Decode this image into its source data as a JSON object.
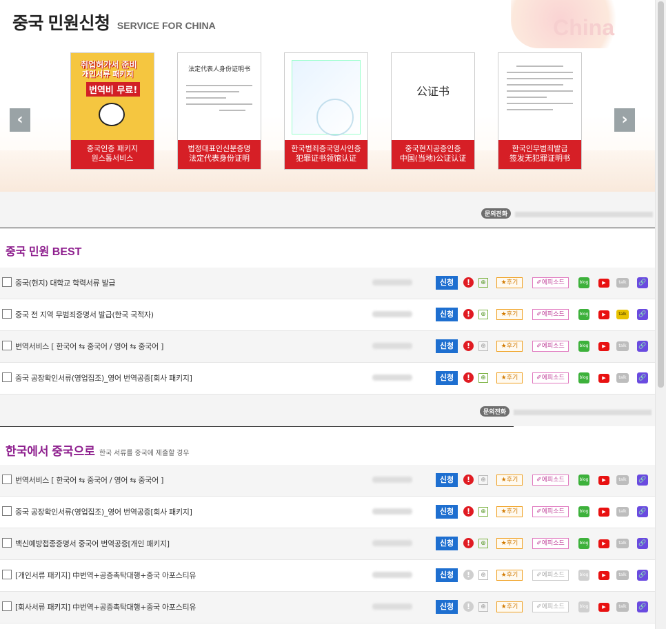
{
  "header": {
    "title": "중국 민원신청",
    "subtitle": "SERVICE FOR CHINA",
    "deco_word": "China"
  },
  "carousel": {
    "prev_icon": "chevron-left-icon",
    "next_icon": "chevron-right-icon",
    "prev_label": "‹",
    "next_label": "›",
    "cards": [
      {
        "line1": "중국인증 패키지",
        "line2": "원스톱서비스",
        "img_text": [
          "취업허가서 준비",
          "개인서류 패키지",
          "번역비 무료!"
        ]
      },
      {
        "line1": "법정대표인신분증명",
        "line2": "法定代表身份证明",
        "img_text": [
          "法定代表人身份证明书"
        ]
      },
      {
        "line1": "한국범죄증국영사인증",
        "line2": "犯罪证书领馆认证",
        "img_text": []
      },
      {
        "line1": "중국현지공증인증",
        "line2": "中国(当地)公证认证",
        "img_text": [
          "公证书"
        ]
      },
      {
        "line1": "한국인무범죄발급",
        "line2": "签发无犯罪证明书",
        "img_text": []
      }
    ]
  },
  "contact": {
    "badge": "문의전화"
  },
  "best": {
    "title": "중국 민원 BEST",
    "rows": [
      {
        "label": "중국(현지) 대학교 학력서류 발급"
      },
      {
        "label": "중국 전 지역 무범죄증명서 발급(한국 국적자)"
      },
      {
        "label": "번역서비스 [ 한국어 ⇆ 중국어 / 영어 ⇆ 중국어 ]"
      },
      {
        "label": "중국 공장확인서류(영업집조)_영어 번역공증[회사 패키지]"
      }
    ]
  },
  "korea_to_china": {
    "title": "한국에서 중국으로",
    "desc": "한국 서류를 중국에 제출할 경우",
    "rows": [
      {
        "label": "번역서비스 [ 한국어 ⇆ 중국어 / 영어 ⇆ 중국어 ]"
      },
      {
        "label": "중국 공장확인서류(영업집조)_영어 번역공증[회사 패키지]"
      },
      {
        "label": "백신예방접종증명서 중국어 번역공증[개인 패키지]"
      },
      {
        "label": "[개인서류 패키지] 中번역+공증촉탁대행+중국 아포스티유"
      },
      {
        "label": "[회사서류 패키지] 中번역+공증촉탁대행+중국 아포스티유"
      }
    ]
  },
  "actions": {
    "apply": "신청",
    "warn": "!",
    "review": "★후기",
    "episode": "✐에피소드",
    "blog": "blog",
    "youtube": "▶",
    "kakao": "talk",
    "link": "🔗"
  },
  "colors": {
    "section_title": "#8e1f8e",
    "apply_button": "#1e6fd0",
    "caption_bg": "#d61f26"
  }
}
